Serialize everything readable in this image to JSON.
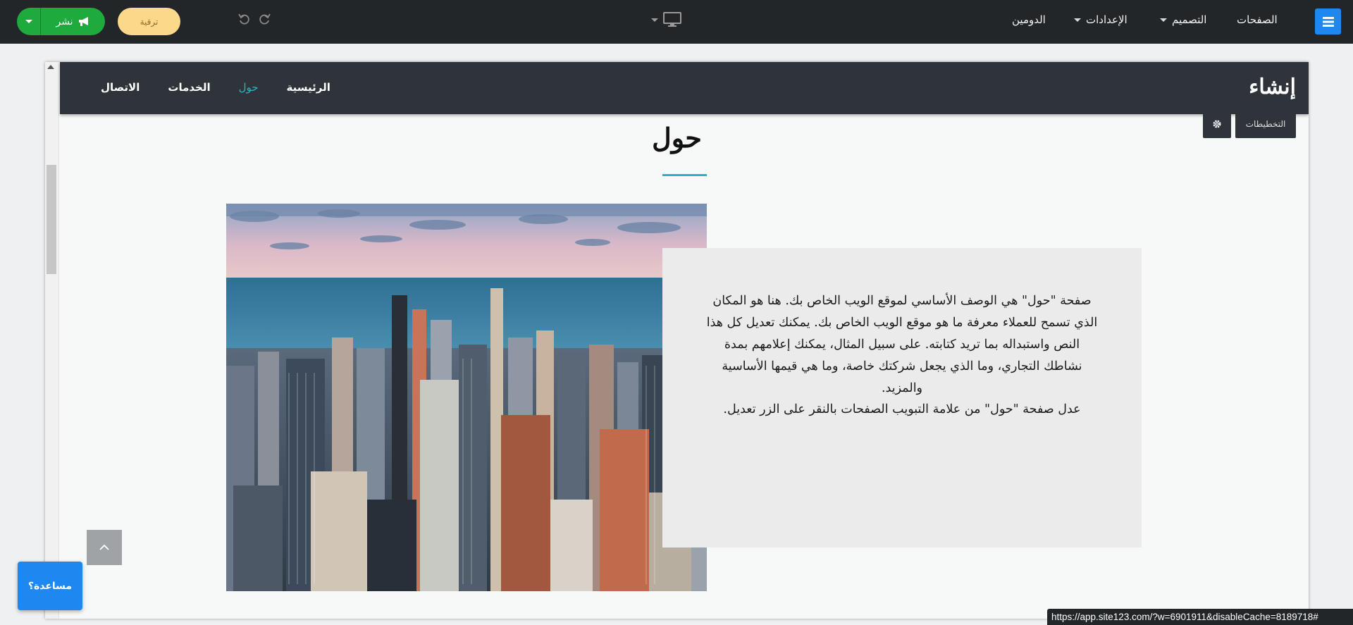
{
  "editor_bar": {
    "logo_icon": "site-menu-icon",
    "nav": {
      "pages": "الصفحات",
      "design": "التصميم",
      "settings": "الإعدادات",
      "domain": "الدومين"
    },
    "device_icon": "desktop-icon",
    "upgrade_label": "ترقية",
    "publish_label": "نشر",
    "colors": {
      "bar_bg": "#222629",
      "publish_green": "#1eaa3c",
      "upgrade_yellow": "#fcd98a",
      "logo_blue": "#1e87f0"
    }
  },
  "site": {
    "brand": "إنشاء",
    "menu": [
      {
        "label": "الرئيسية",
        "active": false
      },
      {
        "label": "حول",
        "active": true
      },
      {
        "label": "الخدمات",
        "active": false
      },
      {
        "label": "الاتصال",
        "active": false
      }
    ],
    "layouts_label": "التخطيطات",
    "accent_color": "#2bb3c4"
  },
  "about": {
    "title": "حول",
    "paragraph1": "صفحة \"حول\" هي الوصف الأساسي لموقع الويب الخاص بك. هنا هو المكان الذي تسمح للعملاء معرفة ما هو موقع الويب الخاص بك. يمكنك تعديل كل هذا النص واستبداله بما تريد كتابته. على سبيل المثال، يمكنك إعلامهم بمدة نشاطك التجاري، وما الذي يجعل شركتك خاصة، وما هي قيمها الأساسية والمزيد.",
    "paragraph2": "عدل صفحة \"حول\" من علامة التبويب الصفحات بالنقر على الزر تعديل.",
    "image": "city-skyline-photo"
  },
  "help_label": "مساعدة؟",
  "status_url": "https://app.site123.com/?w=6901911&disableCache=8189718#"
}
